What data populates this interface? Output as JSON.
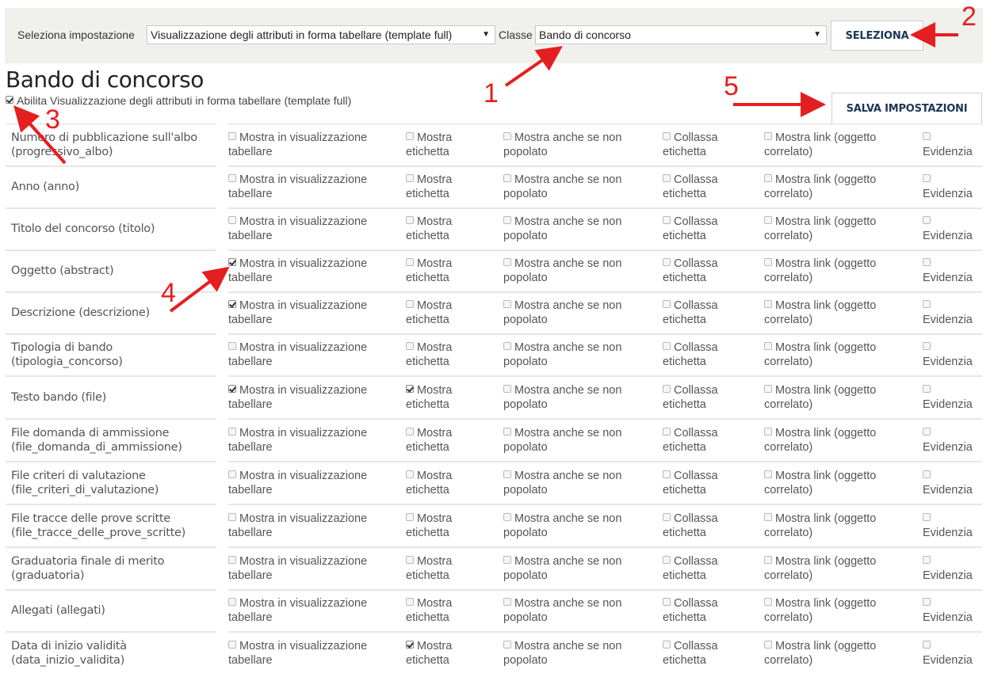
{
  "toolbar": {
    "setting_label": "Seleziona impostazione",
    "setting_value": "Visualizzazione degli attributi in forma tabellare (template full)",
    "class_label": "Classe",
    "class_value": "Bando di concorso",
    "select_button": "SELEZIONA"
  },
  "page": {
    "title": "Bando di concorso",
    "enable_label": "Abilita Visualizzazione degli attributi in forma tabellare (template full)",
    "enable_checked": true,
    "save_button": "SALVA IMPOSTAZIONI"
  },
  "annotations": [
    "1",
    "2",
    "3",
    "4",
    "5"
  ],
  "option_labels": {
    "show_table": [
      "Mostra in visualizzazione",
      "tabellare"
    ],
    "show_label": [
      "Mostra",
      "etichetta"
    ],
    "show_empty": [
      "Mostra anche se non",
      "popolato"
    ],
    "collapse": [
      "Collassa",
      "etichetta"
    ],
    "show_link": [
      "Mostra link (oggetto",
      "correlato)"
    ],
    "highlight": [
      "",
      "Evidenzia"
    ]
  },
  "attributes": [
    {
      "name": [
        "Numero di pubblicazione sull'albo",
        "(progressivo_albo)"
      ],
      "checks": [
        false,
        false,
        false,
        false,
        false,
        false
      ]
    },
    {
      "name": [
        "Anno (anno)"
      ],
      "checks": [
        false,
        false,
        false,
        false,
        false,
        false
      ]
    },
    {
      "name": [
        "Titolo del concorso (titolo)"
      ],
      "checks": [
        false,
        false,
        false,
        false,
        false,
        false
      ]
    },
    {
      "name": [
        "Oggetto (abstract)"
      ],
      "checks": [
        true,
        false,
        false,
        false,
        false,
        false
      ]
    },
    {
      "name": [
        "Descrizione (descrizione)"
      ],
      "checks": [
        true,
        false,
        false,
        false,
        false,
        false
      ]
    },
    {
      "name": [
        "Tipologia di bando",
        "(tipologia_concorso)"
      ],
      "checks": [
        false,
        false,
        false,
        false,
        false,
        false
      ]
    },
    {
      "name": [
        "Testo bando (file)"
      ],
      "checks": [
        true,
        true,
        false,
        false,
        false,
        false
      ]
    },
    {
      "name": [
        "File domanda di ammissione",
        "(file_domanda_di_ammissione)"
      ],
      "checks": [
        false,
        false,
        false,
        false,
        false,
        false
      ]
    },
    {
      "name": [
        "File criteri di valutazione",
        "(file_criteri_di_valutazione)"
      ],
      "checks": [
        false,
        false,
        false,
        false,
        false,
        false
      ]
    },
    {
      "name": [
        "File tracce delle prove scritte",
        "(file_tracce_delle_prove_scritte)"
      ],
      "checks": [
        false,
        false,
        false,
        false,
        false,
        false
      ]
    },
    {
      "name": [
        "Graduatoria finale di merito",
        "(graduatoria)"
      ],
      "checks": [
        false,
        false,
        false,
        false,
        false,
        false
      ]
    },
    {
      "name": [
        "Allegati (allegati)"
      ],
      "checks": [
        false,
        false,
        false,
        false,
        false,
        false
      ]
    },
    {
      "name": [
        "Data di inizio validità",
        "(data_inizio_validita)"
      ],
      "checks": [
        false,
        true,
        false,
        false,
        false,
        false
      ]
    }
  ],
  "colors": {
    "annotation": "#e41f1f",
    "button_text": "#1d3557",
    "toolbar_bg": "#f0f0ec"
  }
}
